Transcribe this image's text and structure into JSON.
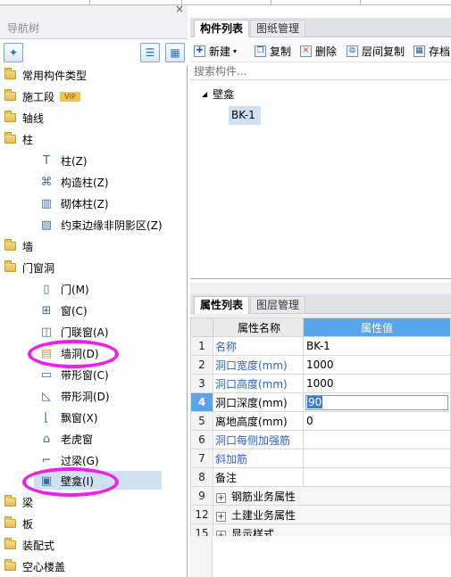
{
  "nav": {
    "title": "导航树",
    "close": "×",
    "items": [
      {
        "label": "常用构件类型",
        "icon": "folder-icon"
      },
      {
        "label": "施工段",
        "icon": "folder-icon",
        "badge": "VIP"
      },
      {
        "label": "轴线",
        "icon": "folder-icon"
      },
      {
        "label": "柱",
        "icon": "folder-open-icon"
      },
      {
        "label": "柱(Z)",
        "icon": "column-icon"
      },
      {
        "label": "构造柱(Z)",
        "icon": "constructional-column-icon"
      },
      {
        "label": "砌体柱(Z)",
        "icon": "masonry-column-icon"
      },
      {
        "label": "约束边缘非阴影区(Z)",
        "icon": "hatched-area-icon"
      },
      {
        "label": "墙",
        "icon": "folder-icon"
      },
      {
        "label": "门窗洞",
        "icon": "folder-open-icon"
      },
      {
        "label": "门(M)",
        "icon": "door-icon"
      },
      {
        "label": "窗(C)",
        "icon": "window-icon"
      },
      {
        "label": "门联窗(A)",
        "icon": "door-window-icon"
      },
      {
        "label": "墙洞(D)",
        "icon": "wall-opening-icon"
      },
      {
        "label": "带形窗(C)",
        "icon": "strip-window-icon"
      },
      {
        "label": "带形洞(D)",
        "icon": "strip-opening-icon"
      },
      {
        "label": "飘窗(X)",
        "icon": "bay-window-icon"
      },
      {
        "label": "老虎窗",
        "icon": "dormer-icon"
      },
      {
        "label": "过梁(G)",
        "icon": "lintel-icon"
      },
      {
        "label": "壁龛(I)",
        "icon": "niche-icon"
      },
      {
        "label": "梁",
        "icon": "folder-icon"
      },
      {
        "label": "板",
        "icon": "folder-icon"
      },
      {
        "label": "装配式",
        "icon": "folder-icon"
      },
      {
        "label": "空心楼盖",
        "icon": "folder-icon"
      }
    ]
  },
  "components": {
    "tabs": [
      "构件列表",
      "图纸管理"
    ],
    "toolbar": [
      "新建",
      "复制",
      "删除",
      "层间复制",
      "存档"
    ],
    "search_placeholder": "搜索构件...",
    "tree_group": "壁龛",
    "tree_item": "BK-1"
  },
  "properties": {
    "tabs": [
      "属性列表",
      "图层管理"
    ],
    "col_name": "属性名称",
    "col_value": "属性值",
    "rows": [
      {
        "n": "1",
        "name": "名称",
        "value": "BK-1"
      },
      {
        "n": "2",
        "name": "洞口宽度(mm)",
        "value": "1000"
      },
      {
        "n": "3",
        "name": "洞口高度(mm)",
        "value": "1000"
      },
      {
        "n": "4",
        "name": "洞口深度(mm)",
        "value": "90"
      },
      {
        "n": "5",
        "name": "离地高度(mm)",
        "value": "0"
      },
      {
        "n": "6",
        "name": "洞口每侧加强筋",
        "value": ""
      },
      {
        "n": "7",
        "name": "斜加筋",
        "value": ""
      },
      {
        "n": "8",
        "name": "备注",
        "value": ""
      },
      {
        "n": "9",
        "name": "钢筋业务属性",
        "value": ""
      },
      {
        "n": "12",
        "name": "土建业务属性",
        "value": ""
      },
      {
        "n": "15",
        "name": "显示样式",
        "value": ""
      }
    ],
    "expand_symbol": "+"
  },
  "colors": {
    "accent": "#2f62c8",
    "highlight": "#ee1eee",
    "selected": "#cfe0f3",
    "value_header": "#5aa4ea"
  }
}
